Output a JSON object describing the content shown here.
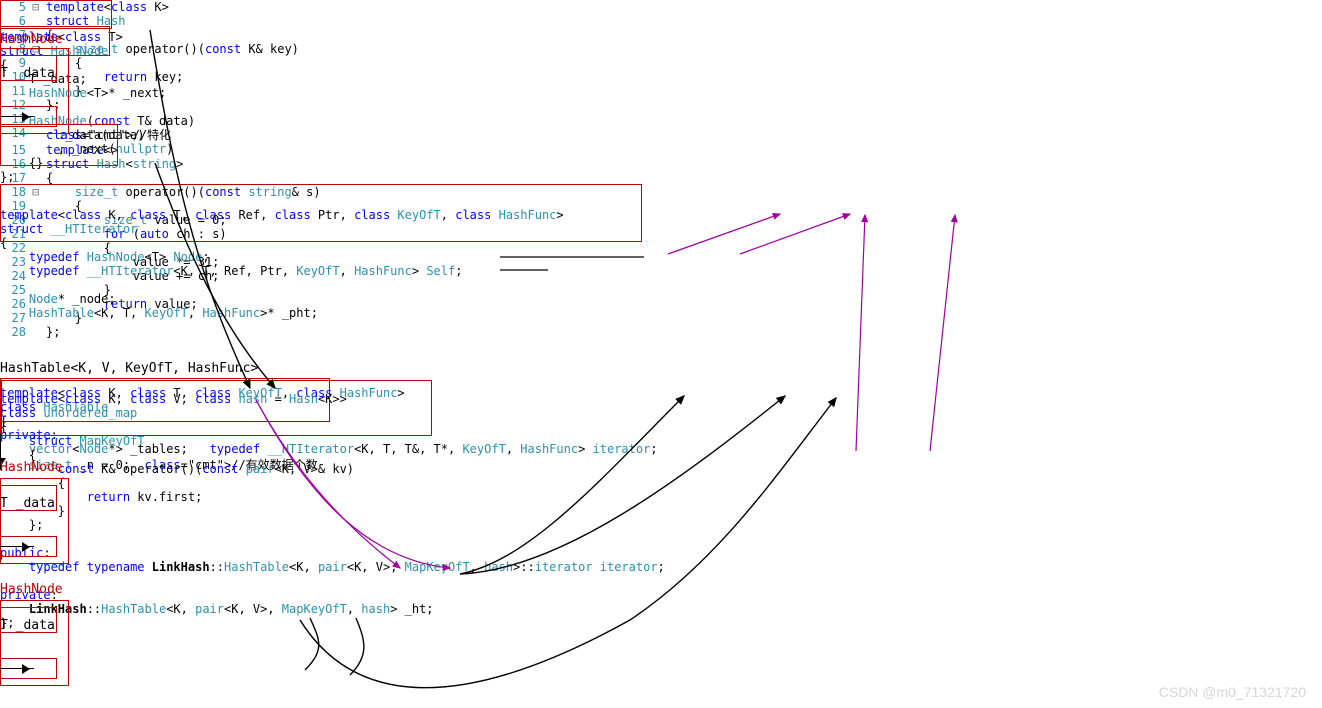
{
  "code_block1": [
    {
      "n": "5",
      "g": "⊟",
      "t": "template<class K>"
    },
    {
      "n": "6",
      "g": "",
      "t": "struct Hash"
    },
    {
      "n": "7",
      "g": "",
      "t": "{"
    },
    {
      "n": "8",
      "g": "⊟",
      "t": "    size_t operator()(const K& key)"
    },
    {
      "n": "9",
      "g": "",
      "t": "    {"
    },
    {
      "n": "10",
      "g": "",
      "t": "        return key;"
    },
    {
      "n": "11",
      "g": "",
      "t": "    }"
    },
    {
      "n": "12",
      "g": "",
      "t": "};"
    },
    {
      "n": "13",
      "g": "",
      "t": ""
    },
    {
      "n": "14",
      "g": "",
      "t": "//特化"
    },
    {
      "n": "15",
      "g": "",
      "t": "template<>"
    },
    {
      "n": "16",
      "g": "",
      "t": "struct Hash<string>"
    },
    {
      "n": "17",
      "g": "",
      "t": "{"
    },
    {
      "n": "18",
      "g": "⊟",
      "t": "    size_t operator()(const string& s)"
    },
    {
      "n": "19",
      "g": "",
      "t": "    {"
    },
    {
      "n": "20",
      "g": "",
      "t": "        size_t value = 0;"
    },
    {
      "n": "21",
      "g": "",
      "t": "        for (auto ch : s)"
    },
    {
      "n": "22",
      "g": "",
      "t": "        {"
    },
    {
      "n": "23",
      "g": "",
      "t": "            value *= 31;"
    },
    {
      "n": "24",
      "g": "",
      "t": "            value += ch;"
    },
    {
      "n": "25",
      "g": "",
      "t": "        }"
    },
    {
      "n": "26",
      "g": "",
      "t": "        return value;"
    },
    {
      "n": "27",
      "g": "",
      "t": "    }"
    },
    {
      "n": "28",
      "g": "",
      "t": "};"
    }
  ],
  "code_hashnode": [
    "template<class T>",
    "struct HashNode",
    "{",
    "    T _data;",
    "    HashNode<T>* _next;",
    "",
    "    HashNode(const T& data)",
    "        :_data(data)",
    "        , _next(nullptr)",
    "    {}",
    "};"
  ],
  "code_iter": [
    "template<class K, class T, class Ref, class Ptr, class KeyOfT, class HashFunc>",
    "struct __HTIterator",
    "{",
    "    typedef HashNode<T> Node;",
    "    typedef __HTIterator<K, T, Ref, Ptr, KeyOfT, HashFunc> Self;",
    "",
    "    Node* _node;",
    "    HashTable<K, T, KeyOfT, HashFunc>* _pht;"
  ],
  "code_hashtable": [
    "template<class K, class T, class KeyOfT, class HashFunc>",
    "class HashTable",
    "{",
    "private:",
    "    vector<Node*> _tables;   typedef __HTIterator<K, T, T&, T*, KeyOfT, HashFunc> iterator;",
    "    size_t _n = 0;  //有效数据个数"
  ],
  "code_map": [
    "template<class K, class V, class hash = Hash<K>>",
    "class unordered_map",
    "{",
    "    struct MapKeyOfT",
    "    {",
    "        const K& operator()(const pair<K, V>& kv)",
    "        {",
    "            return kv.first;",
    "        }",
    "    };",
    "",
    "public:",
    "    typedef typename LinkHash::HashTable<K, pair<K, V>, MapKeyOfT, hash>::iterator iterator;",
    "",
    "private:",
    "    LinkHash::HashTable<K, pair<K, V>, MapKeyOfT, hash> _ht;",
    "};"
  ],
  "hashnode_title": "HashNode",
  "tdata": "T _data",
  "hashtable_title": "HashTable<K, V, KeyOfT, HashFunc>",
  "watermark": "CSDN @m0_71321720"
}
